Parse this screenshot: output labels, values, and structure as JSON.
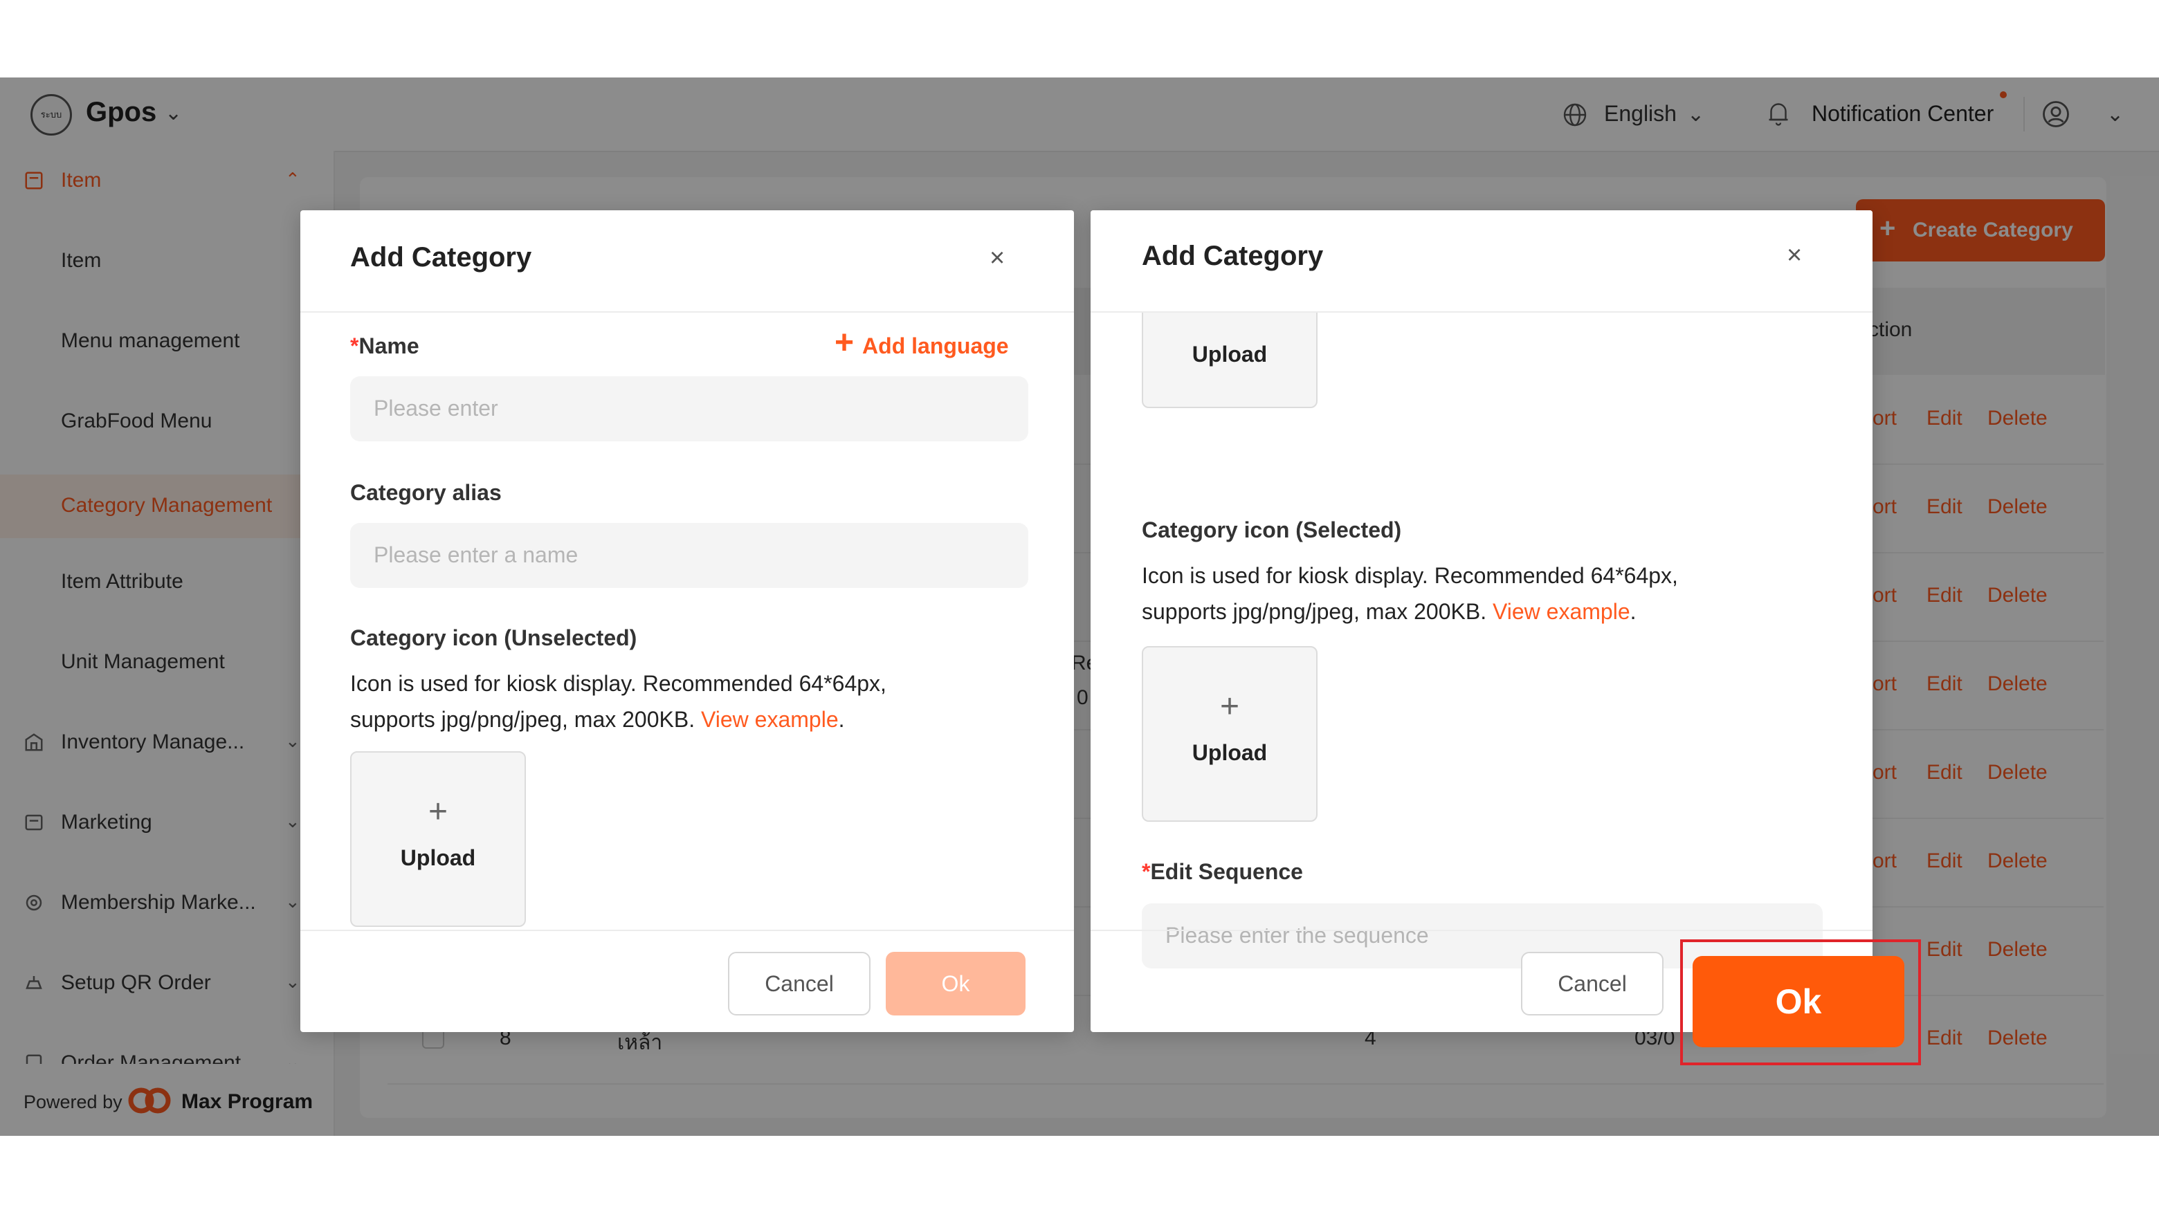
{
  "app": {
    "logo_text": "ระบบ",
    "name": "Gpos"
  },
  "topbar": {
    "language": "English",
    "notification": "Notification Center"
  },
  "sidebar": {
    "items": [
      {
        "label": "Item",
        "icon": "item-icon"
      },
      {
        "label": "Item"
      },
      {
        "label": "Menu management"
      },
      {
        "label": "GrabFood Menu"
      },
      {
        "label": "Category Management"
      },
      {
        "label": "Item Attribute"
      },
      {
        "label": "Unit Management"
      },
      {
        "label": "Inventory Manage...",
        "icon": "inventory-icon"
      },
      {
        "label": "Marketing",
        "icon": "marketing-icon"
      },
      {
        "label": "Membership Marke...",
        "icon": "membership-icon"
      },
      {
        "label": "Setup QR Order",
        "icon": "qr-icon"
      },
      {
        "label": "Order Management",
        "icon": "order-icon"
      }
    ],
    "powered_by": "Powered by",
    "powered_brand": "Max Program"
  },
  "background": {
    "create_button": "Create Category",
    "action_header": "ction",
    "row_actions": {
      "sort": "ort",
      "edit": "Edit",
      "delete": "Delete"
    },
    "row_8": {
      "index": "8",
      "name": "เหล้า",
      "count": "4",
      "date": "03/0"
    },
    "peek_1": "Re",
    "peek_2": "0"
  },
  "modal_left": {
    "title": "Add Category",
    "name_label": "Name",
    "add_language": "Add language",
    "name_placeholder": "Please enter",
    "alias_label": "Category alias",
    "alias_placeholder": "Please enter a name",
    "icon_label": "Category icon (Unselected)",
    "helper_line1": "Icon is used for kiosk display. Recommended 64*64px,",
    "helper_line2": "supports jpg/png/jpeg, max 200KB.",
    "helper_link": "View example",
    "upload": "Upload",
    "cancel": "Cancel",
    "ok": "Ok"
  },
  "modal_right": {
    "title": "Add Category",
    "upload_top": "Upload",
    "icon_label": "Category icon (Selected)",
    "helper_line1": "Icon is used for kiosk display. Recommended 64*64px,",
    "helper_line2": "supports jpg/png/jpeg, max 200KB.",
    "helper_link": "View example",
    "upload": "Upload",
    "sequence_label": "Edit Sequence",
    "sequence_placeholder": "Please enter the sequence",
    "cancel": "Cancel",
    "ok": "Ok"
  },
  "colors": {
    "accent": "#ff5a1f",
    "highlight": "#e0242a"
  }
}
